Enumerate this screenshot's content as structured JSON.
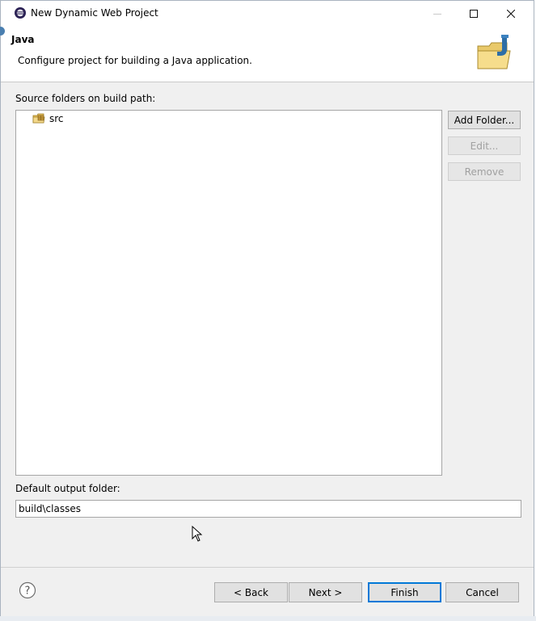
{
  "window": {
    "title": "New Dynamic Web Project",
    "icons": {
      "app": "eclipse-icon",
      "minimize": "minimize-icon",
      "maximize": "maximize-icon",
      "close": "close-icon"
    }
  },
  "banner": {
    "title": "Java",
    "description": "Configure project for building a Java application.",
    "icon": "java-folder-icon"
  },
  "source": {
    "label": "Source folders on build path:",
    "items": [
      {
        "label": "src",
        "icon": "package-folder-icon"
      }
    ],
    "buttons": {
      "add": "Add Folder...",
      "edit": "Edit...",
      "remove": "Remove"
    }
  },
  "output": {
    "label": "Default output folder:",
    "value": "build\\classes"
  },
  "footer": {
    "help_icon": "help-icon",
    "back": "< Back",
    "next": "Next >",
    "finish": "Finish",
    "cancel": "Cancel"
  },
  "colors": {
    "accent": "#0078d7",
    "disabled_text": "#a0a0a0"
  }
}
